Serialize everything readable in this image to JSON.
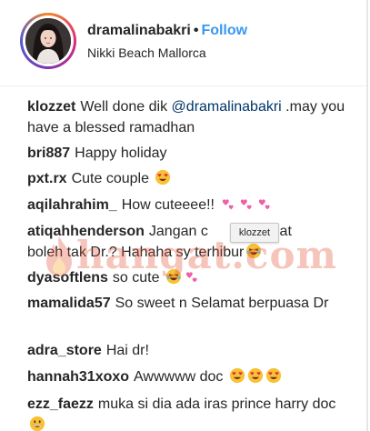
{
  "post_header": {
    "username": "dramalinabakri",
    "separator": "•",
    "follow_label": "Follow",
    "location": "Nikki Beach Mallorca"
  },
  "comments": [
    {
      "user": "klozzet",
      "text_before": "Well done dik ",
      "mention": "@dramalinabakri",
      "text_after": " .may you have a blessed ramadhan",
      "emojis": []
    },
    {
      "user": "bri887",
      "text": "Happy holiday",
      "emojis": []
    },
    {
      "user": "pxt.rx",
      "text": "Cute couple",
      "emojis": [
        "heart-eyes-emoji"
      ]
    },
    {
      "user": "aqilahrahim_",
      "text": "How cuteeee!!",
      "emojis": [
        "two-hearts-emoji",
        "two-hearts-emoji",
        "two-hearts-emoji"
      ]
    },
    {
      "user": "atiqahhenderson",
      "text": "Jangan c",
      "text_hidden_gap": "angat",
      "text_line2": "boleh tak Dr.? Hahaha sy terhibur",
      "emojis": [
        "laughing-emoji"
      ]
    },
    {
      "user": "dyasoftlens",
      "text": "so cute",
      "emojis": [
        "laughing-emoji",
        "two-hearts-emoji"
      ]
    },
    {
      "user": "mamalida57",
      "text": "So sweet n Selamat berpuasa Dr",
      "emojis": []
    },
    {
      "user": "adra_store",
      "text": "Hai dr!",
      "emojis": []
    },
    {
      "user": "hannah31xoxo",
      "text": "Awwwww doc",
      "emojis": [
        "heart-eyes-emoji",
        "heart-eyes-emoji",
        "heart-eyes-emoji"
      ]
    },
    {
      "user": "ezz_faezz",
      "text": "muka si dia ada iras prince harry doc",
      "emojis": [
        "grinning-emoji"
      ]
    }
  ],
  "tooltip": {
    "text": "klozzet"
  },
  "watermark": {
    "text": "hangat.com"
  },
  "colors": {
    "follow": "#3897f0",
    "mention": "#003569",
    "text": "#262626",
    "divider": "#efefef",
    "watermark": "#e4573a"
  }
}
